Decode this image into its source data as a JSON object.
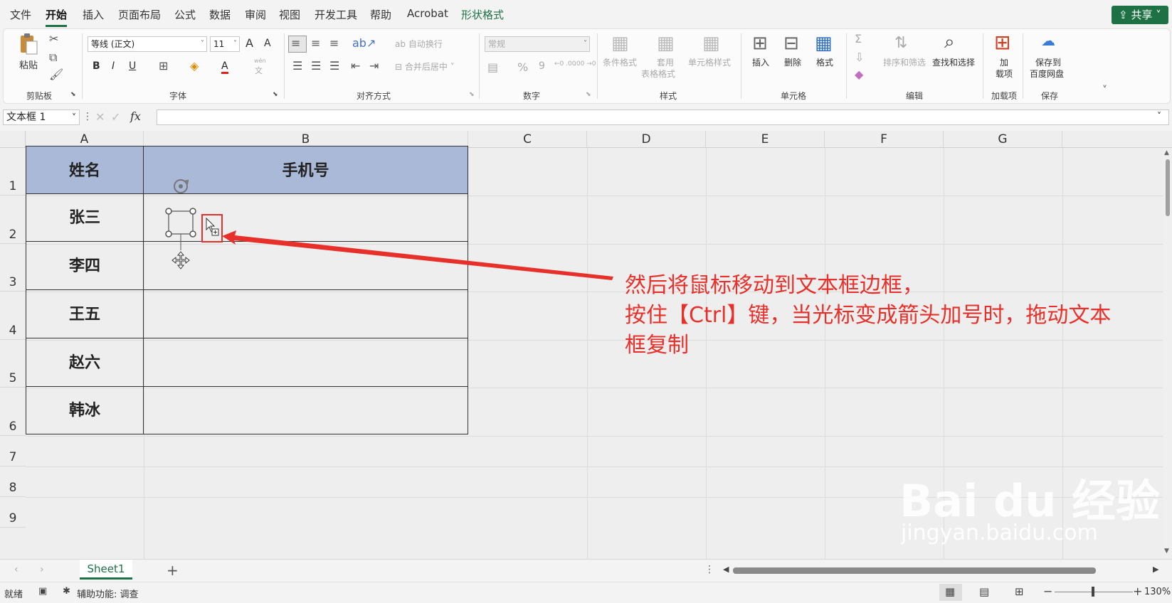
{
  "menu": {
    "items": [
      "文件",
      "开始",
      "插入",
      "页面布局",
      "公式",
      "数据",
      "审阅",
      "视图",
      "开发工具",
      "帮助",
      "Acrobat",
      "形状格式"
    ],
    "share": "共享"
  },
  "ribbon": {
    "clipboard": {
      "paste": "粘贴",
      "label": "剪贴板"
    },
    "font": {
      "name": "等线 (正文)",
      "size": "11",
      "grow": "A",
      "shrink": "A",
      "bold": "B",
      "italic": "I",
      "underline": "U",
      "fontcolor": "A",
      "phonetic": "文",
      "phonetic_top": "wén",
      "label": "字体"
    },
    "align": {
      "wrap": "自动换行",
      "merge": "合并后居中",
      "label": "对齐方式"
    },
    "number": {
      "format": "常规",
      "percent": "%",
      "comma": "9",
      "inc": "←0 .00",
      "dec": ".00 →0",
      "label": "数字"
    },
    "styles": {
      "cond": "条件格式",
      "table1": "套用",
      "table2": "表格格式",
      "cell": "单元格样式",
      "label": "样式"
    },
    "cells": {
      "insert": "插入",
      "delete": "删除",
      "format": "格式",
      "label": "单元格"
    },
    "edit": {
      "sort": "排序和筛选",
      "find": "查找和选择",
      "label": "编辑"
    },
    "addins": {
      "line1": "加",
      "line2": "载项",
      "label": "加载项"
    },
    "save": {
      "line1": "保存到",
      "line2": "百度网盘",
      "label": "保存"
    }
  },
  "formula": {
    "namebox": "文本框 1",
    "fx": "fx",
    "cancel": "✕",
    "enter": "✓"
  },
  "sheet": {
    "columns": [
      "A",
      "B",
      "C",
      "D",
      "E",
      "F",
      "G"
    ],
    "rows": [
      "1",
      "2",
      "3",
      "4",
      "5",
      "6",
      "7",
      "8",
      "9"
    ],
    "header": {
      "name": "姓名",
      "phone": "手机号"
    },
    "names": [
      "张三",
      "李四",
      "王五",
      "赵六",
      "韩冰"
    ],
    "header_fill": "#a9b9d7"
  },
  "annotation": {
    "line1": "然后将鼠标移动到文本框边框，",
    "line2": "按住【Ctrl】键，当光标变成箭头加号时，拖动文本",
    "line3": "框复制",
    "color": "#e8302a"
  },
  "tabs": {
    "sheet1": "Sheet1",
    "add": "+"
  },
  "status": {
    "ready": "就绪",
    "accessibility": "辅助功能: 调查",
    "zoom": "130%",
    "minus": "−",
    "plus": "+"
  },
  "watermark": {
    "brand": "Bai du 经验",
    "url": "jingyan.baidu.com"
  }
}
